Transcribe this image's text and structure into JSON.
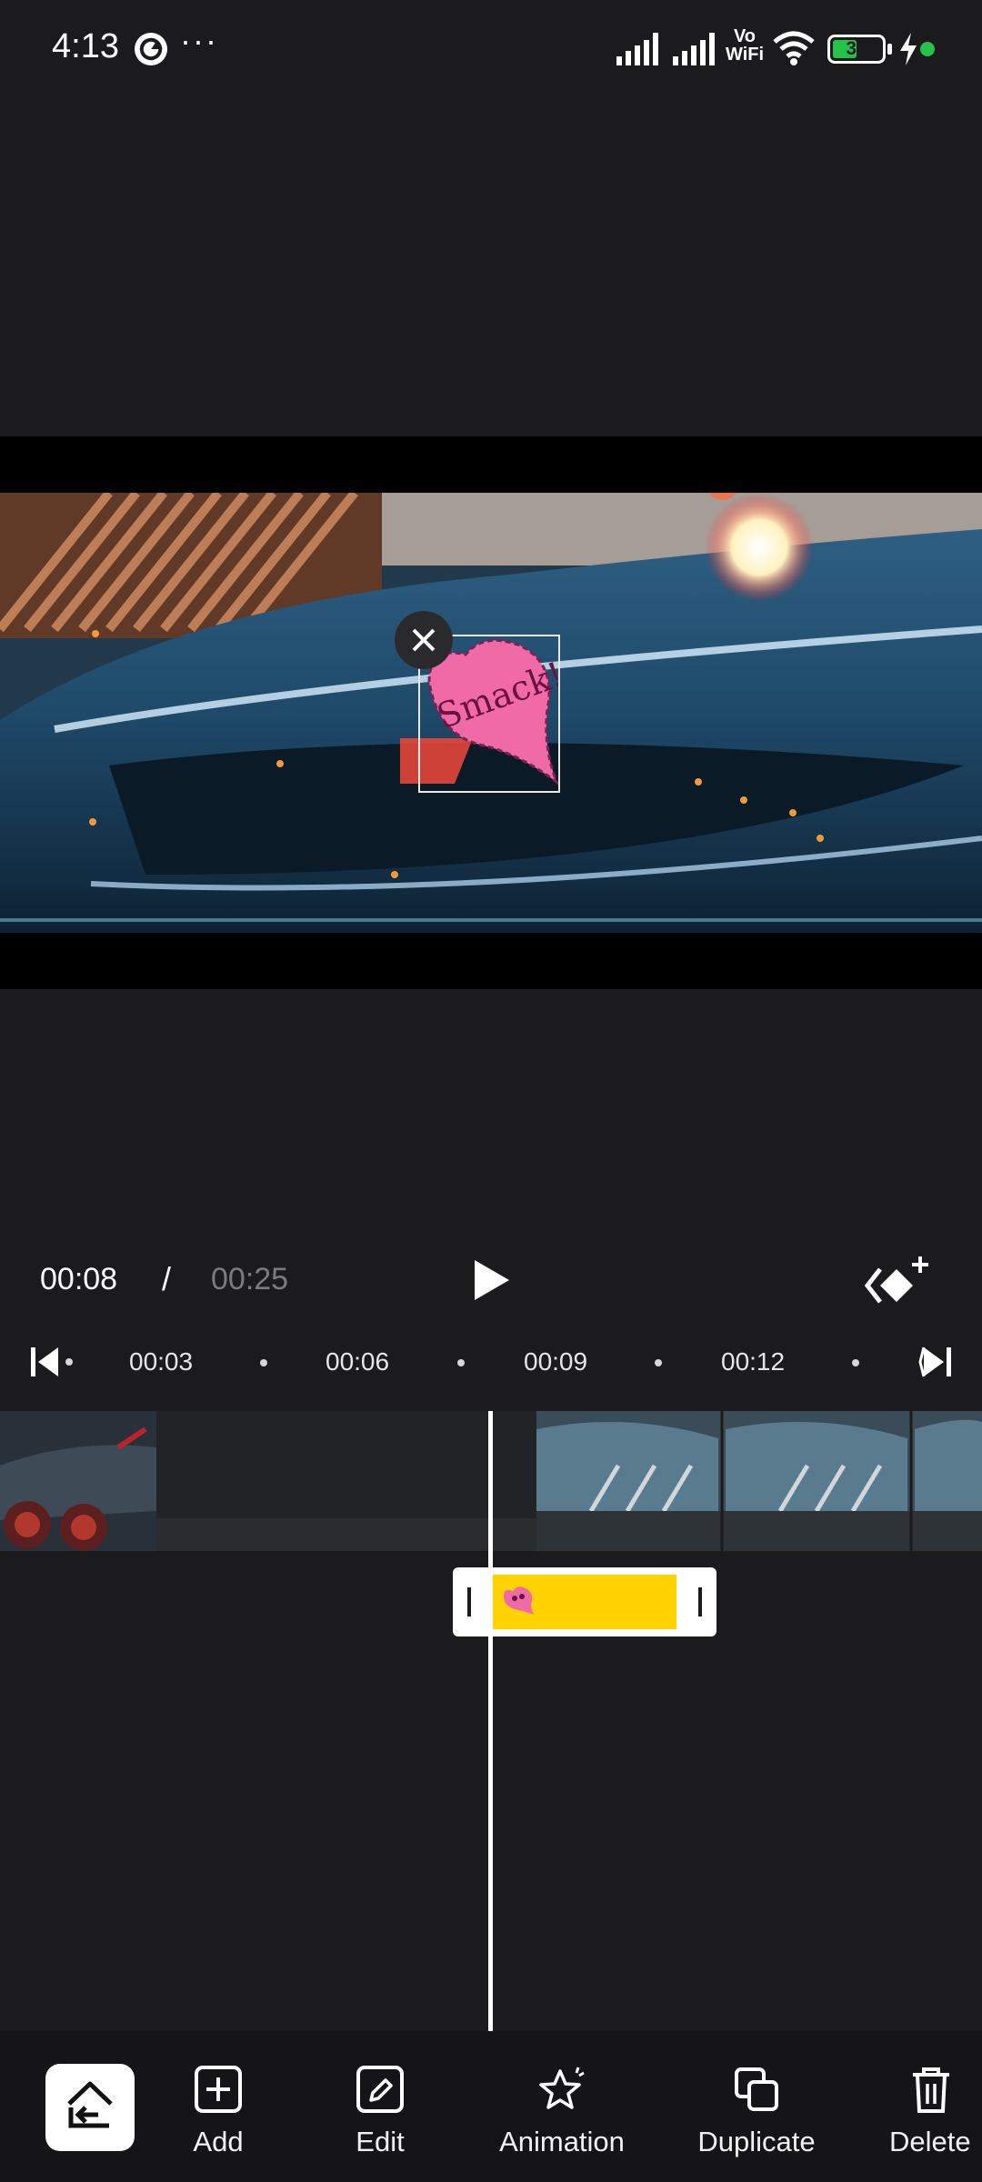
{
  "status_bar": {
    "time": "4:13",
    "more": "···",
    "network_label_top": "Vo",
    "network_label_bottom": "WiFi",
    "battery": "39",
    "icons": [
      "app-icon",
      "signal-icon",
      "signal-icon",
      "vowifi-icon",
      "wifi-icon",
      "battery-icon",
      "charging-icon",
      "dot-icon"
    ]
  },
  "preview": {
    "sticker_text": "Smack!"
  },
  "playback": {
    "current_time": "00:08",
    "separator": "/",
    "total_time": "00:25"
  },
  "ruler": {
    "labels": [
      "00:03",
      "00:06",
      "00:09",
      "00:12"
    ]
  },
  "toolbar": {
    "items": [
      {
        "label": "Add",
        "icon": "plus-square-icon"
      },
      {
        "label": "Edit",
        "icon": "pencil-icon"
      },
      {
        "label": "Animation",
        "icon": "star-sparkle-icon"
      },
      {
        "label": "Duplicate",
        "icon": "duplicate-icon"
      },
      {
        "label": "Delete",
        "icon": "trash-icon"
      }
    ]
  },
  "colors": {
    "background": "#1b1b1d",
    "sticker_strip": "#ffd200",
    "accent_green": "#25c24a",
    "muted_time": "#7b7b7d"
  }
}
